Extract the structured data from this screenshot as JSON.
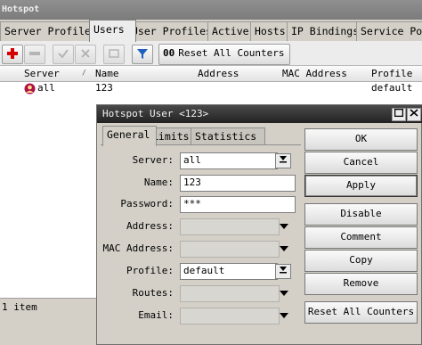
{
  "window": {
    "title": "Hotspot"
  },
  "tabs": [
    "Server Profiles",
    "Users",
    "User Profiles",
    "Active",
    "Hosts",
    "IP Bindings",
    "Service Por"
  ],
  "toolbar": {
    "reset_counters_prefix": "00",
    "reset_counters_label": "Reset All Counters"
  },
  "table": {
    "columns": [
      "Server",
      "Name",
      "Address",
      "MAC Address",
      "Profile"
    ],
    "rows": [
      {
        "server": "all",
        "name": "123",
        "address": "",
        "mac": "",
        "profile": "default"
      }
    ]
  },
  "status": {
    "count": "1 item"
  },
  "dialog": {
    "title": "Hotspot User <123>",
    "tabs": [
      "General",
      "Limits",
      "Statistics"
    ],
    "fields": {
      "server": {
        "label": "Server:",
        "value": "all"
      },
      "name": {
        "label": "Name:",
        "value": "123"
      },
      "password": {
        "label": "Password:",
        "value": "***"
      },
      "address": {
        "label": "Address:",
        "value": ""
      },
      "mac": {
        "label": "MAC Address:",
        "value": ""
      },
      "profile": {
        "label": "Profile:",
        "value": "default"
      },
      "routes": {
        "label": "Routes:",
        "value": ""
      },
      "email": {
        "label": "Email:",
        "value": ""
      }
    },
    "buttons": {
      "ok": "OK",
      "cancel": "Cancel",
      "apply": "Apply",
      "disable": "Disable",
      "comment": "Comment",
      "copy": "Copy",
      "remove": "Remove",
      "reset": "Reset All Counters"
    }
  },
  "colors": {
    "add": "#d40000",
    "filter": "#1f5fbf"
  }
}
